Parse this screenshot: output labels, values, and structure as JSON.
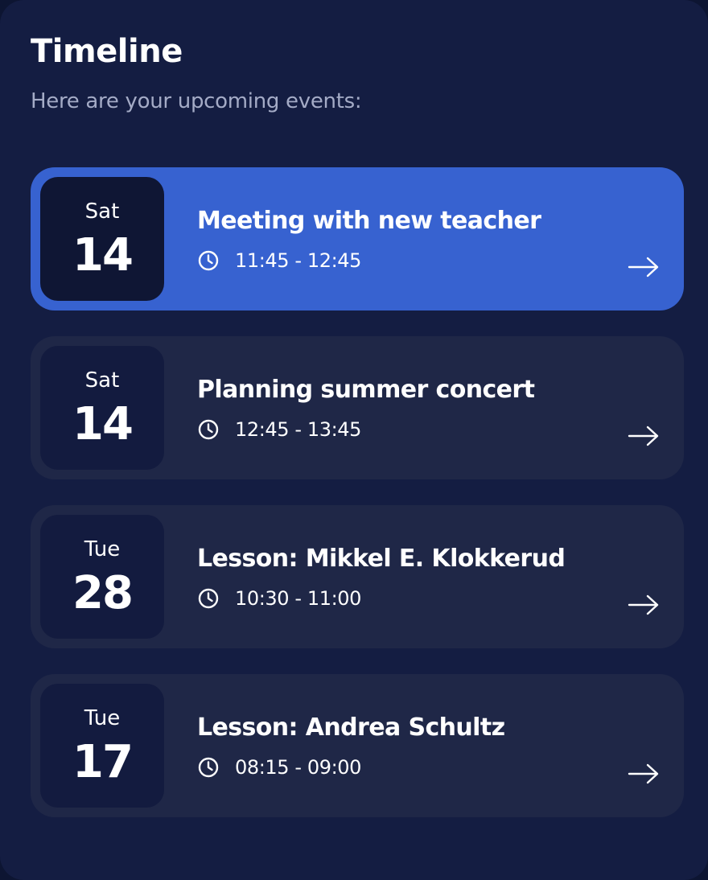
{
  "header": {
    "title": "Timeline",
    "subtitle": "Here are your upcoming events:"
  },
  "events": [
    {
      "day_of_week": "Sat",
      "day": "14",
      "title": "Meeting with new teacher",
      "time": "11:45 - 12:45",
      "active": true
    },
    {
      "day_of_week": "Sat",
      "day": "14",
      "title": "Planning summer concert",
      "time": "12:45 - 13:45",
      "active": false
    },
    {
      "day_of_week": "Tue",
      "day": "28",
      "title": "Lesson: Mikkel E. Klokkerud",
      "time": "10:30 - 11:00",
      "active": false
    },
    {
      "day_of_week": "Tue",
      "day": "17",
      "title": "Lesson: Andrea Schultz",
      "time": "08:15 - 09:00",
      "active": false
    }
  ],
  "icons": {
    "time": "clock-icon",
    "open": "arrow-right-icon"
  },
  "colors": {
    "background": "#141d42",
    "card": "#1f2747",
    "active_card": "#3762d0",
    "date_box": "#131b3f",
    "subtitle_text": "#a4abc6"
  }
}
